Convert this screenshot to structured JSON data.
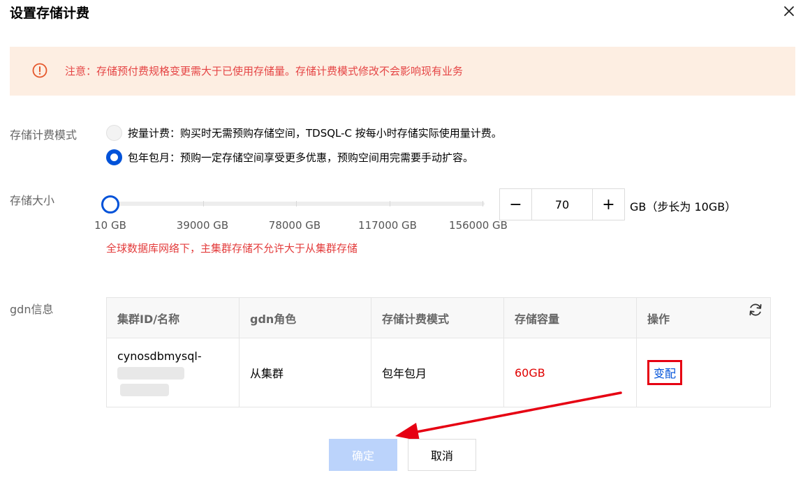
{
  "dialog": {
    "title": "设置存储计费"
  },
  "notice": {
    "text": "注意：存储预付费规格变更需大于已使用存储量。存储计费模式修改不会影响现有业务"
  },
  "billing_mode": {
    "label": "存储计费模式",
    "options": [
      {
        "text": "按量计费：购买时无需预购存储空间，TDSQL-C 按每小时存储实际使用量计费。",
        "selected": false
      },
      {
        "text": "包年包月：预购一定存储空间享受更多优惠，预购空间用完需要手动扩容。",
        "selected": true
      }
    ]
  },
  "storage_size": {
    "label": "存储大小",
    "min": 10,
    "max": 195000,
    "value": 70,
    "ticks": [
      "10 GB",
      "39000 GB",
      "78000 GB",
      "117000 GB",
      "156000 GB"
    ],
    "minus_symbol": "−",
    "plus_symbol": "+",
    "unit": "GB（步长为 10GB）",
    "warning": "全球数据库网络下，主集群存储不允许大于从集群存储"
  },
  "gdn": {
    "label": "gdn信息",
    "columns": [
      "集群ID/名称",
      "gdn角色",
      "存储计费模式",
      "存储容量",
      "操作"
    ],
    "rows": [
      {
        "cluster_id": "cynosdbmysql-",
        "role": "从集群",
        "billing": "包年包月",
        "capacity": "60GB",
        "action": "变配"
      }
    ]
  },
  "footer": {
    "confirm": "确定",
    "cancel": "取消"
  },
  "colors": {
    "primary": "#0052d9",
    "notice_bg": "#fdeee2",
    "warning_text": "#e33c3c",
    "highlight_box": "#e60012"
  },
  "icons": {
    "close": "close-icon",
    "notice": "alert-circle-icon",
    "refresh": "refresh-icon"
  }
}
